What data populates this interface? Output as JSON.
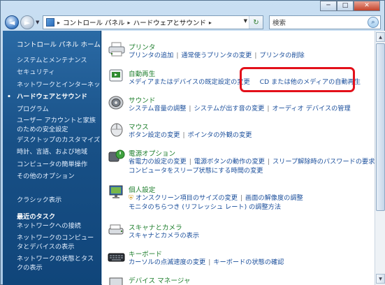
{
  "window": {
    "caption_buttons": [
      "─",
      "□",
      "✕"
    ]
  },
  "toolbar": {
    "back_glyph": "◄",
    "forward_glyph": "►",
    "address": [
      "コントロール パネル",
      "ハードウェアとサウンド"
    ],
    "search_placeholder": "検索"
  },
  "nav": {
    "home": "コントロール パネル ホーム",
    "items": [
      "システムとメンテナンス",
      "セキュリティ",
      "ネットワークとインターネット",
      "ハードウェアとサウンド",
      "プログラム",
      "ユーザー アカウントと家族のための安全設定",
      "デスクトップのカスタマイズ",
      "時計、言語、および地域",
      "コンピュータの簡単操作",
      "その他のオプション"
    ],
    "classic": "クラシック表示",
    "tasks_title": "最近のタスク",
    "tasks": [
      "ネットワークへの接続",
      "ネットワークのコンピュータとデバイスの表示",
      "ネットワークの状態とタスクの表示"
    ]
  },
  "categories": [
    {
      "title": "プリンタ",
      "icon": "printer-icon",
      "links": [
        "プリンタの追加",
        "通常使うプリンタの変更",
        "プリンタの削除"
      ]
    },
    {
      "title": "自動再生",
      "icon": "autoplay-icon",
      "links": [
        "メディアまたはデバイスの既定設定の変更",
        "CD または他のメディアの自動再生"
      ]
    },
    {
      "title": "サウンド",
      "icon": "speaker-icon",
      "links": [
        "システム音量の調整",
        "システムが出す音の変更",
        "オーディオ デバイスの管理"
      ]
    },
    {
      "title": "マウス",
      "icon": "mouse-icon",
      "links": [
        "ボタン設定の変更",
        "ポインタの外観の変更"
      ]
    },
    {
      "title": "電源オプション",
      "icon": "power-icon",
      "links": [
        "省電力の設定の変更",
        "電源ボタンの動作の変更",
        "スリープ解除時のパスワードの要求",
        "コンピュータをスリープ状態にする時間の変更"
      ]
    },
    {
      "title": "個人設定",
      "icon": "display-icon",
      "links": [
        "オンスクリーン項目のサイズの変更",
        "画面の解像度の調整",
        "モニタのちらつき (リフレッシュ レート) の調整方法"
      ]
    },
    {
      "title": "スキャナとカメラ",
      "icon": "scanner-icon",
      "links": [
        "スキャナとカメラの表示"
      ]
    },
    {
      "title": "キーボード",
      "icon": "keyboard-icon",
      "links": [
        "カーソルの点滅速度の変更",
        "キーボードの状態の確認"
      ]
    },
    {
      "title": "デバイス マネージャ",
      "icon": "device-manager-icon",
      "links": []
    }
  ]
}
